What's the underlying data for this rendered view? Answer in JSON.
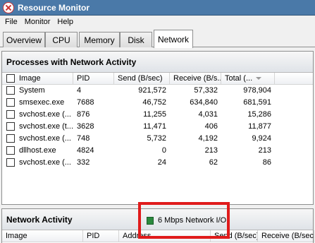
{
  "window": {
    "title": "Resource Monitor"
  },
  "menu": [
    "File",
    "Monitor",
    "Help"
  ],
  "tabs": [
    {
      "label": "Overview"
    },
    {
      "label": "CPU"
    },
    {
      "label": "Memory"
    },
    {
      "label": "Disk"
    },
    {
      "label": "Network",
      "active": true
    }
  ],
  "processes": {
    "title": "Processes with Network Activity",
    "columns": [
      "Image",
      "PID",
      "Send (B/sec)",
      "Receive (B/s...",
      "Total (..."
    ],
    "rows": [
      {
        "image": "System",
        "pid": "4",
        "send": "921,572",
        "receive": "57,332",
        "total": "978,904"
      },
      {
        "image": "smsexec.exe",
        "pid": "7688",
        "send": "46,752",
        "receive": "634,840",
        "total": "681,591"
      },
      {
        "image": "svchost.exe (...",
        "pid": "876",
        "send": "11,255",
        "receive": "4,031",
        "total": "15,286"
      },
      {
        "image": "svchost.exe (t...",
        "pid": "3628",
        "send": "11,471",
        "receive": "406",
        "total": "11,877"
      },
      {
        "image": "svchost.exe (...",
        "pid": "748",
        "send": "5,732",
        "receive": "4,192",
        "total": "9,924"
      },
      {
        "image": "dllhost.exe",
        "pid": "4824",
        "send": "0",
        "receive": "213",
        "total": "213"
      },
      {
        "image": "svchost.exe (...",
        "pid": "332",
        "send": "24",
        "receive": "62",
        "total": "86"
      }
    ]
  },
  "network_activity": {
    "title": "Network Activity",
    "badge": "6 Mbps Network I/O",
    "columns": [
      "Image",
      "PID",
      "Address",
      "Send (B/sec)",
      "Receive (B/sec)"
    ]
  }
}
